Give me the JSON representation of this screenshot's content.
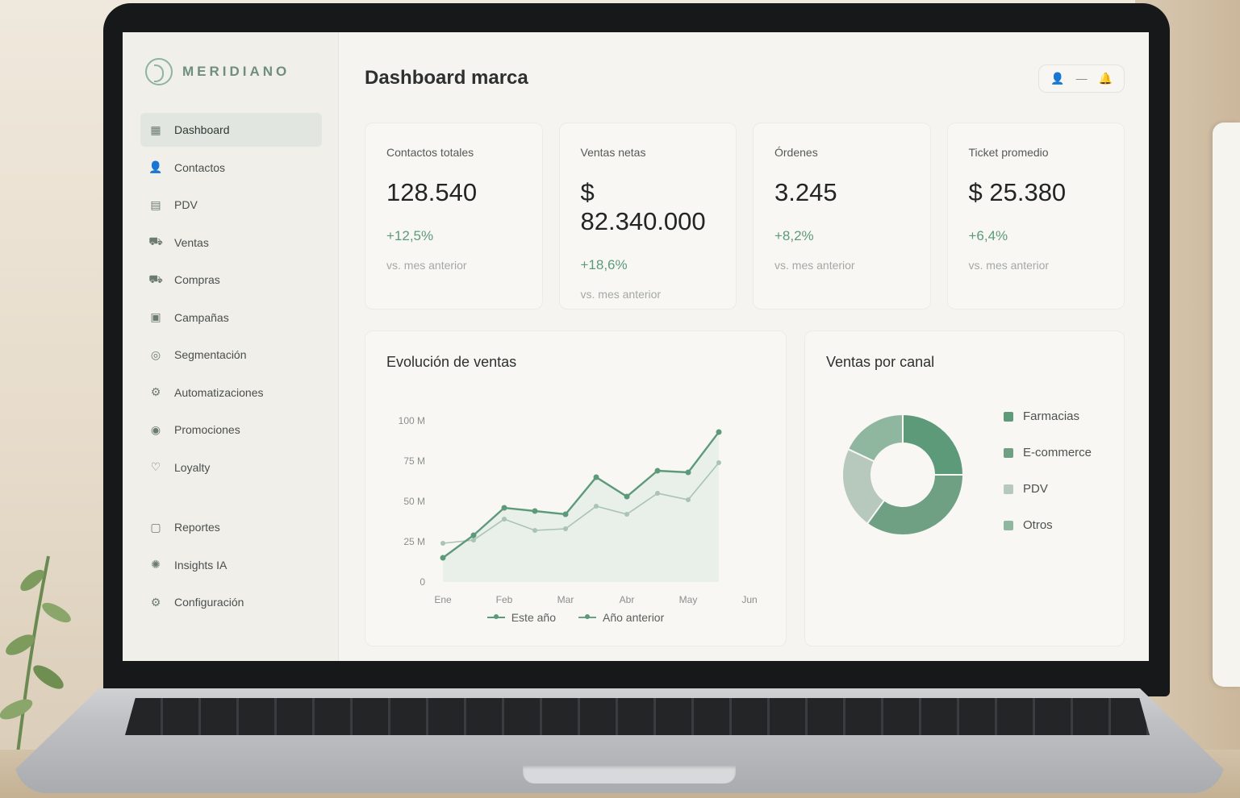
{
  "app": {
    "brand": "MERIDIANO",
    "page_title": "Dashboard marca"
  },
  "sidebar": {
    "items": [
      {
        "label": "Dashboard",
        "icon": "dashboard-icon",
        "active": true
      },
      {
        "label": "Contactos",
        "icon": "users-icon"
      },
      {
        "label": "PDV",
        "icon": "store-icon"
      },
      {
        "label": "Ventas",
        "icon": "cart-icon"
      },
      {
        "label": "Compras",
        "icon": "cart-icon"
      },
      {
        "label": "Campañas",
        "icon": "campaign-icon"
      },
      {
        "label": "Segmentación",
        "icon": "segment-icon"
      },
      {
        "label": "Automatizaciones",
        "icon": "automation-icon"
      },
      {
        "label": "Promociones",
        "icon": "promotion-icon"
      },
      {
        "label": "Loyalty",
        "icon": "loyalty-icon"
      }
    ],
    "secondary": [
      {
        "label": "Reportes",
        "icon": "report-icon"
      },
      {
        "label": "Insights IA",
        "icon": "insights-icon"
      },
      {
        "label": "Configuración",
        "icon": "settings-icon"
      }
    ]
  },
  "kpis": [
    {
      "label": "Contactos totales",
      "value": "128.540",
      "delta": "+12,5%",
      "note": "vs. mes anterior"
    },
    {
      "label": "Ventas netas",
      "value": "$ 82.340.000",
      "delta": "+18,6%",
      "note": "vs. mes anterior"
    },
    {
      "label": "Órdenes",
      "value": "3.245",
      "delta": "+8,2%",
      "note": "vs. mes anterior"
    },
    {
      "label": "Ticket promedio",
      "value": "$ 25.380",
      "delta": "+6,4%",
      "note": "vs. mes anterior"
    }
  ],
  "colors": {
    "accent": "#5d9a7a",
    "accent_light": "#a9c3b4"
  },
  "chart_data": [
    {
      "type": "line",
      "title": "Evolución de ventas",
      "categories": [
        "Ene",
        "Feb",
        "Mar",
        "Abr",
        "May",
        "Jun"
      ],
      "y_ticks": [
        "0",
        "25 M",
        "50 M",
        "75 M",
        "100 M"
      ],
      "ylim": [
        0,
        100
      ],
      "x": [
        0,
        0.5,
        1,
        1.5,
        2,
        2.5,
        3,
        3.5,
        4,
        4.5,
        5
      ],
      "series": [
        {
          "name": "Este año",
          "values": [
            15,
            29,
            46,
            44,
            42,
            65,
            53,
            69,
            68,
            93
          ]
        },
        {
          "name": "Año anterior",
          "values": [
            24,
            26,
            39,
            32,
            33,
            47,
            42,
            55,
            51,
            74
          ]
        }
      ],
      "legend": "bottom",
      "grid": false
    },
    {
      "type": "pie",
      "title": "Ventas por canal",
      "categories": [
        "Farmacias",
        "E-commerce",
        "PDV",
        "Otros"
      ],
      "values": [
        25,
        35,
        22,
        18
      ],
      "colors": [
        "#5d9a7a",
        "#6fa084",
        "#b6c9bc",
        "#8fb7a0"
      ],
      "legend": "right"
    }
  ]
}
